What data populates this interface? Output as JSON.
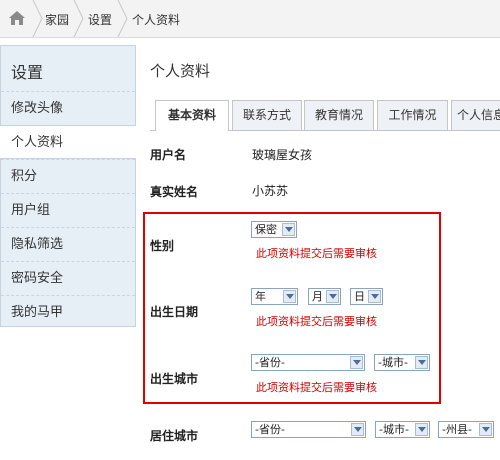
{
  "breadcrumb": {
    "icon": "home-icon",
    "items": [
      "家园",
      "设置",
      "个人资料"
    ]
  },
  "sidebar": {
    "title": "设置",
    "items": [
      "修改头像",
      "个人资料",
      "积分",
      "用户组",
      "隐私筛选",
      "密码安全",
      "我的马甲"
    ],
    "active": "个人资料"
  },
  "main": {
    "title": "个人资料",
    "tabs": [
      "基本资料",
      "联系方式",
      "教育情况",
      "工作情况",
      "个人信息"
    ],
    "active_tab": "基本资料",
    "fields": {
      "username": {
        "label": "用户名",
        "value": "玻璃屋女孩"
      },
      "realname": {
        "label": "真实姓名",
        "value": "小苏苏"
      },
      "gender": {
        "label": "性别",
        "select": "保密",
        "note": "此项资料提交后需要审核"
      },
      "birthday": {
        "label": "出生日期",
        "year": "年",
        "month": "月",
        "day": "日",
        "note": "此项资料提交后需要审核"
      },
      "birthcity": {
        "label": "出生城市",
        "province": "-省份-",
        "city": "-城市-",
        "note": "此项资料提交后需要审核"
      },
      "residecity": {
        "label": "居住城市",
        "province": "-省份-",
        "city": "-城市-",
        "county": "-州县-"
      }
    }
  },
  "colors": {
    "highlight_border": "#e00000",
    "note_text": "#d40000",
    "sidebar_bg": "#e6eef6"
  }
}
